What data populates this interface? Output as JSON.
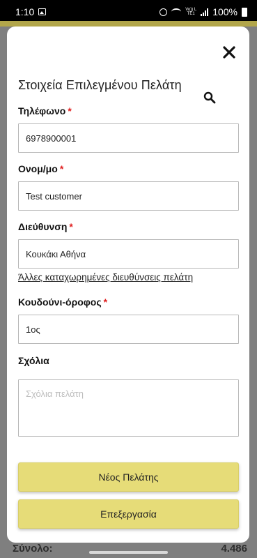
{
  "status_bar": {
    "time": "1:10",
    "battery": "100%",
    "network_small": "Vo)) LTE1"
  },
  "background": {
    "total_label": "Σύνολο:",
    "total_value": "4.486"
  },
  "modal": {
    "title": "Στοιχεία Επιλεγμένου Πελάτη",
    "close_icon": "close-icon",
    "search_icon": "search-icon",
    "phone": {
      "label": "Τηλέφωνο",
      "required": "*",
      "value": "6978900001"
    },
    "name": {
      "label": "Ονομ/μο",
      "required": "*",
      "value": "Test customer"
    },
    "address": {
      "label": "Διεύθυνση",
      "required": "*",
      "value": "Κουκάκι Αθήνα"
    },
    "other_addresses_link": "Άλλες καταχωρημένες διευθύνσεις πελάτη",
    "doorbell": {
      "label": "Κουδούνι-όροφος",
      "required": "*",
      "value": "1ος"
    },
    "comments": {
      "label": "Σχόλια",
      "placeholder": "Σχόλια πελάτη",
      "value": ""
    },
    "new_customer_button": "Νέος Πελάτης",
    "edit_button": "Επεξεργασία"
  },
  "colors": {
    "button_yellow": "#e6dc78",
    "required_red": "#e02020",
    "backdrop": "#7f7f7f"
  }
}
